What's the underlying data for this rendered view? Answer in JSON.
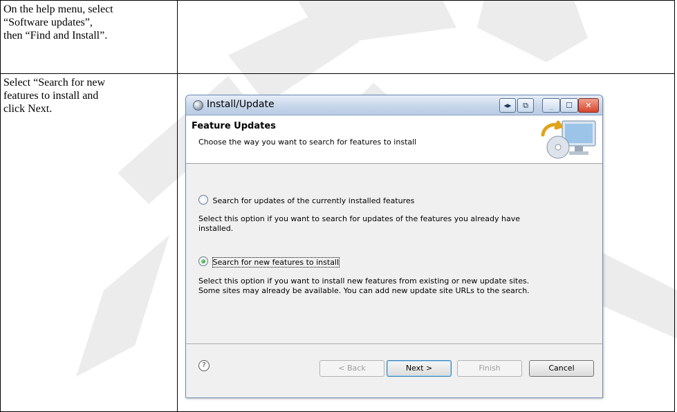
{
  "instructions": [
    {
      "text": "On the help menu, select\n“Software updates”,\nthen “Find and Install”."
    },
    {
      "text": "Select “Search for new\nfeatures to install and\nclick Next."
    }
  ],
  "dialog": {
    "title": "Install/Update",
    "titlebar_buttons": [
      "◂▸",
      "⧉",
      "_",
      "☐",
      "✕"
    ],
    "banner": {
      "title": "Feature Updates",
      "subtitle": "Choose the way you want to search for features to install",
      "art_icon": "cd-monitor-icon"
    },
    "options": [
      {
        "label": "Search for updates of the currently installed features",
        "description": "Select this option if you want to search for updates of the features you already have\ninstalled.",
        "selected": false
      },
      {
        "label": "Search for new features to install",
        "description": "Select this option if you want to install new features from existing or new update sites.\nSome sites may already be available. You can add new update site URLs to the search.",
        "selected": true
      }
    ],
    "buttons": {
      "help": "?",
      "back": "< Back",
      "next": "Next >",
      "finish": "Finish",
      "cancel": "Cancel"
    }
  },
  "colors": {
    "titlebar": "#c7d6ea",
    "dialog_bg": "#f0f0f0",
    "watermark": "#e9e9e9"
  }
}
